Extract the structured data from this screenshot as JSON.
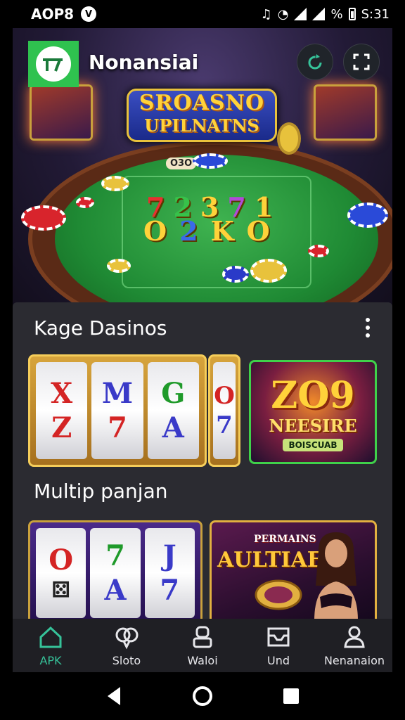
{
  "status_bar": {
    "left_text": "AOP8",
    "app_badge": "V",
    "time": "S:31"
  },
  "header": {
    "app_name": "Nonansiai",
    "refresh_icon": "refresh-icon",
    "expand_icon": "expand-icon"
  },
  "hero": {
    "banner_line1": "SROASNO",
    "banner_line2": "UPILNATNS",
    "table_label": "O3O",
    "numbers_row1": [
      "7",
      "2",
      "3",
      "7",
      "1"
    ],
    "numbers_row2": [
      "O",
      "2",
      "K",
      "O"
    ]
  },
  "sections": [
    {
      "title": "Kage Dasinos",
      "menu_icon": "more-vertical-icon",
      "cards": [
        {
          "type": "slot",
          "reels": [
            [
              "X",
              "Z"
            ],
            [
              "M",
              "7"
            ],
            [
              "G",
              "A"
            ],
            [
              "O",
              "7"
            ]
          ]
        },
        {
          "type": "promo",
          "big": "ZO9",
          "mid": "NEESIRE",
          "small": "BOISCUAB"
        }
      ]
    },
    {
      "title": "Multip panjan",
      "cards": [
        {
          "type": "slot",
          "reels": [
            [
              "O",
              "?"
            ],
            [
              "7",
              "A"
            ],
            [
              "J",
              "7"
            ]
          ]
        },
        {
          "type": "promo",
          "top": "PERMAINS",
          "main": "AULTIAEN"
        }
      ]
    }
  ],
  "bottom_nav": [
    {
      "label": "APK",
      "icon": "home-icon",
      "active": true
    },
    {
      "label": "Sloto",
      "icon": "chat-bubbles-icon",
      "active": false
    },
    {
      "label": "Waloi",
      "icon": "wallet-icon",
      "active": false
    },
    {
      "label": "Und",
      "icon": "inbox-icon",
      "active": false
    },
    {
      "label": "Nenanaion",
      "icon": "person-icon",
      "active": false
    }
  ],
  "colors": {
    "accent": "#36c39a",
    "logo_green": "#2fc24f",
    "panel_bg": "#2b2b31",
    "nav_bg": "#1f1f24"
  }
}
